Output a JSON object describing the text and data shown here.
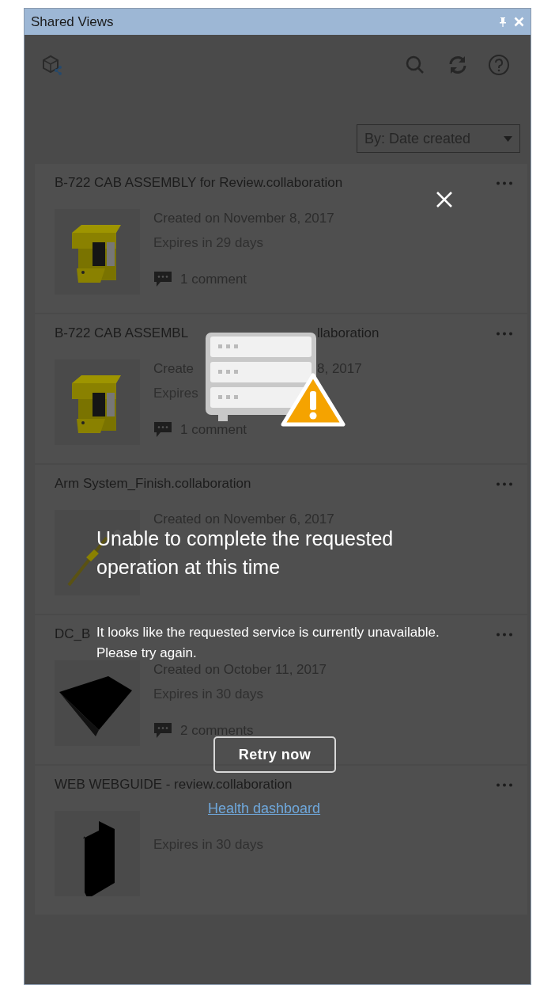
{
  "window": {
    "title": "Shared Views"
  },
  "sort": {
    "label": "By: Date created"
  },
  "items": [
    {
      "kind": "full",
      "thumbnail": {
        "kind": "cab"
      },
      "title": "B-722 CAB ASSEMBLY for Review.collaboration",
      "created": "Created on November 8, 2017",
      "expires": "Expires in 29 days",
      "comments": "1 comment"
    },
    {
      "kind": "obscured",
      "thumbnail": {
        "kind": "cab"
      },
      "title_parts": [
        "B-722 CAB ASSEMBL",
        "llaboration"
      ],
      "created_parts": [
        "Create",
        "8, 2017"
      ],
      "expires": "Expires",
      "comments": "1 comment"
    },
    {
      "kind": "full",
      "thumbnail": {
        "kind": "arm"
      },
      "title": "Arm System_Finish.collaboration",
      "created": "Created on November 6, 2017"
    },
    {
      "kind": "full",
      "thumbnail": {
        "kind": "plate"
      },
      "title": "DC_B",
      "created": "Created on October 11, 2017",
      "expires": "Expires in 30 days",
      "comments": "2 comments"
    },
    {
      "kind": "full",
      "thumbnail": {
        "kind": "block"
      },
      "title": "WEB WEBGUIDE - review.collaboration",
      "expires": "Expires in 30 days"
    }
  ],
  "error": {
    "heading": "Unable to complete the requested operation at this time",
    "message": "It looks like the requested service is currently unavailable. Please try again.",
    "retry_button": "Retry now",
    "link": "Health dashboard"
  }
}
